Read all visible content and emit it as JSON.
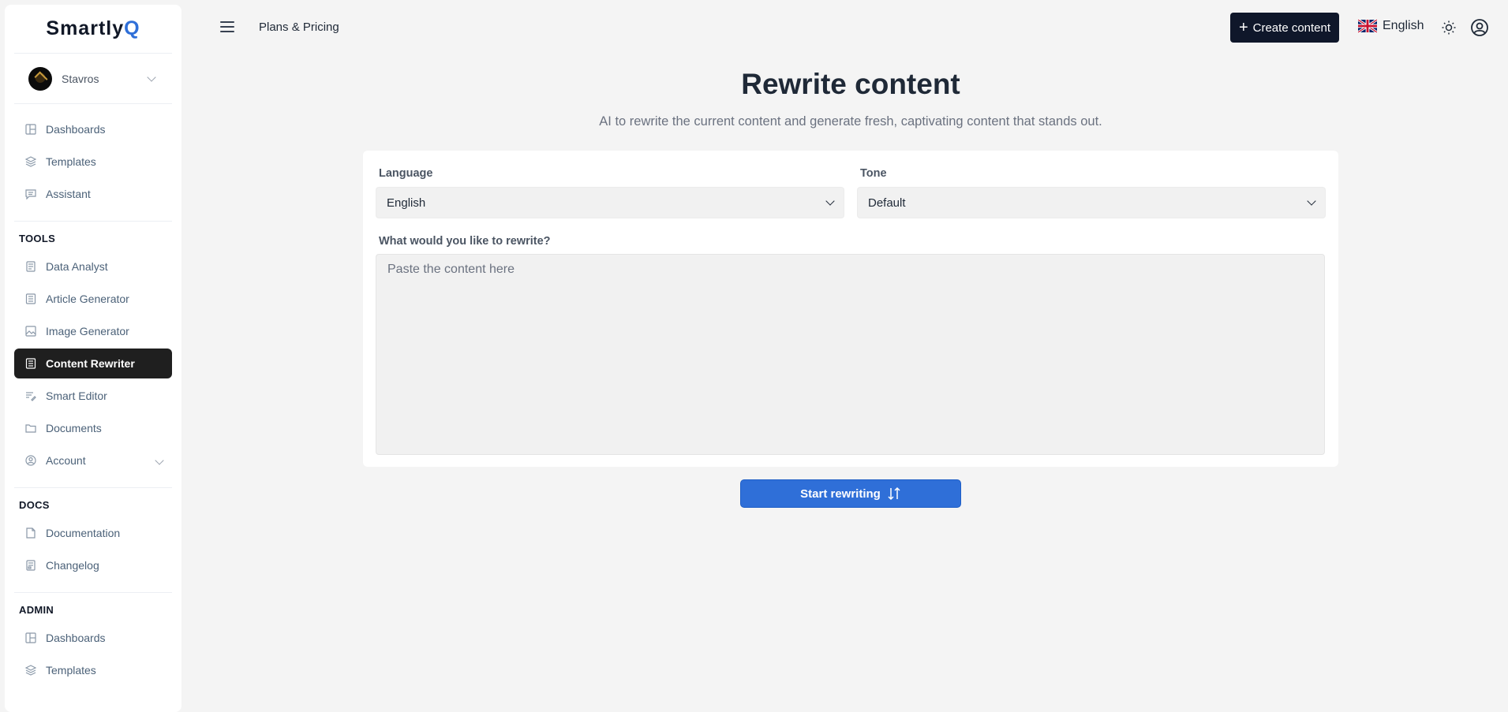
{
  "brand": {
    "name_main": "Smartly",
    "name_accent": "Q"
  },
  "user": {
    "name": "Stavros"
  },
  "sidebar": {
    "main": [
      {
        "label": "Dashboards",
        "icon": "dashboard-icon"
      },
      {
        "label": "Templates",
        "icon": "layers-icon"
      },
      {
        "label": "Assistant",
        "icon": "chat-icon"
      }
    ],
    "tools": {
      "title": "TOOLS",
      "items": [
        {
          "label": "Data Analyst",
          "icon": "data-icon"
        },
        {
          "label": "Article Generator",
          "icon": "article-icon"
        },
        {
          "label": "Image Generator",
          "icon": "image-icon"
        },
        {
          "label": "Content Rewriter",
          "icon": "rewriter-icon",
          "active": true
        },
        {
          "label": "Smart Editor",
          "icon": "editor-icon"
        },
        {
          "label": "Documents",
          "icon": "folder-icon"
        },
        {
          "label": "Account",
          "icon": "account-icon"
        }
      ]
    },
    "docs": {
      "title": "DOCS",
      "items": [
        {
          "label": "Documentation",
          "icon": "doc-icon"
        },
        {
          "label": "Changelog",
          "icon": "changelog-icon"
        }
      ]
    },
    "admin": {
      "title": "ADMIN",
      "items": [
        {
          "label": "Dashboards",
          "icon": "dashboard-icon"
        },
        {
          "label": "Templates",
          "icon": "layers-icon"
        }
      ]
    }
  },
  "topbar": {
    "plans_label": "Plans & Pricing",
    "create_label": "Create content",
    "language": "English"
  },
  "main": {
    "title": "Rewrite content",
    "subtitle": "AI to rewrite the current content and generate fresh, captivating content that stands out.",
    "language_label": "Language",
    "language_value": "English",
    "tone_label": "Tone",
    "tone_value": "Default",
    "rewrite_label": "What would you like to rewrite?",
    "rewrite_placeholder": "Paste the content here",
    "start_button": "Start rewriting"
  },
  "colors": {
    "accent": "#2f6fd8",
    "dark": "#1f1f1f",
    "button_dark": "#0f172a"
  }
}
